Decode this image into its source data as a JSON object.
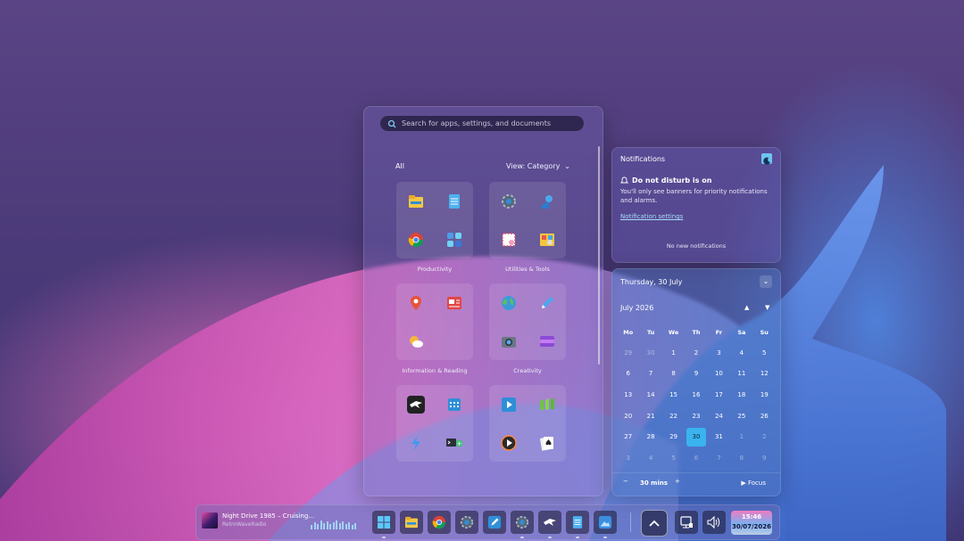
{
  "start_menu": {
    "search_placeholder": "Search for apps, settings, and documents",
    "filter_label": "All",
    "view_label": "View: Category",
    "categories": [
      {
        "label": "Productivity",
        "apps": [
          "file-explorer-icon",
          "notepad-icon",
          "chrome-icon",
          "widgets-icon"
        ]
      },
      {
        "label": "Utilities & Tools",
        "apps": [
          "settings-icon",
          "people-icon",
          "snipping-tool-icon",
          "control-panel-icon"
        ]
      },
      {
        "label": "Information & Reading",
        "apps": [
          "maps-icon",
          "news-icon",
          "weather-icon",
          ""
        ]
      },
      {
        "label": "Creativity",
        "apps": [
          "browser-globe-icon",
          "draw-icon",
          "camera-icon",
          "video-editor-icon"
        ]
      },
      {
        "label": "",
        "apps": [
          "game-eagle-icon",
          "calendar-icon",
          "power-automate-icon",
          "terminal-icon"
        ]
      },
      {
        "label": "",
        "apps": [
          "media-player-icon",
          "solitaire-board-icon",
          "play-icon",
          "solitaire-icon"
        ]
      }
    ]
  },
  "notifications": {
    "title": "Notifications",
    "dnd_title": "Do not disturb is on",
    "dnd_desc": "You'll only see banners for priority notifications and alarms.",
    "settings_link": "Notification settings",
    "empty": "No new notifications"
  },
  "calendar": {
    "today_label": "Thursday, 30 July",
    "month_label": "July 2026",
    "weekdays": [
      "Mo",
      "Tu",
      "We",
      "Th",
      "Fr",
      "Sa",
      "Su"
    ],
    "weeks": [
      [
        "29",
        "30",
        "1",
        "2",
        "3",
        "4",
        "5"
      ],
      [
        "6",
        "7",
        "8",
        "9",
        "10",
        "11",
        "12"
      ],
      [
        "13",
        "14",
        "15",
        "16",
        "17",
        "18",
        "19"
      ],
      [
        "20",
        "21",
        "22",
        "23",
        "24",
        "25",
        "26"
      ],
      [
        "27",
        "28",
        "29",
        "30",
        "31",
        "1",
        "2"
      ],
      [
        "3",
        "4",
        "5",
        "6",
        "7",
        "8",
        "9"
      ]
    ],
    "dim_days": [
      [
        0,
        0
      ],
      [
        0,
        1
      ],
      [
        4,
        5
      ],
      [
        4,
        6
      ],
      [
        5,
        0
      ],
      [
        5,
        1
      ],
      [
        5,
        2
      ],
      [
        5,
        3
      ],
      [
        5,
        4
      ],
      [
        5,
        5
      ],
      [
        5,
        6
      ]
    ],
    "selected": [
      4,
      3
    ],
    "focus_minutes": "30 mins",
    "focus_label": "Focus"
  },
  "taskbar": {
    "media_title": "Night Drive 1985 – Cruising...",
    "media_source": "RetroWaveRadio",
    "time": "15:46",
    "date": "30/07/2026"
  },
  "colors": {
    "accent": "#3ab3ee",
    "link": "#a9dcf8",
    "panel": "#786ebe"
  }
}
